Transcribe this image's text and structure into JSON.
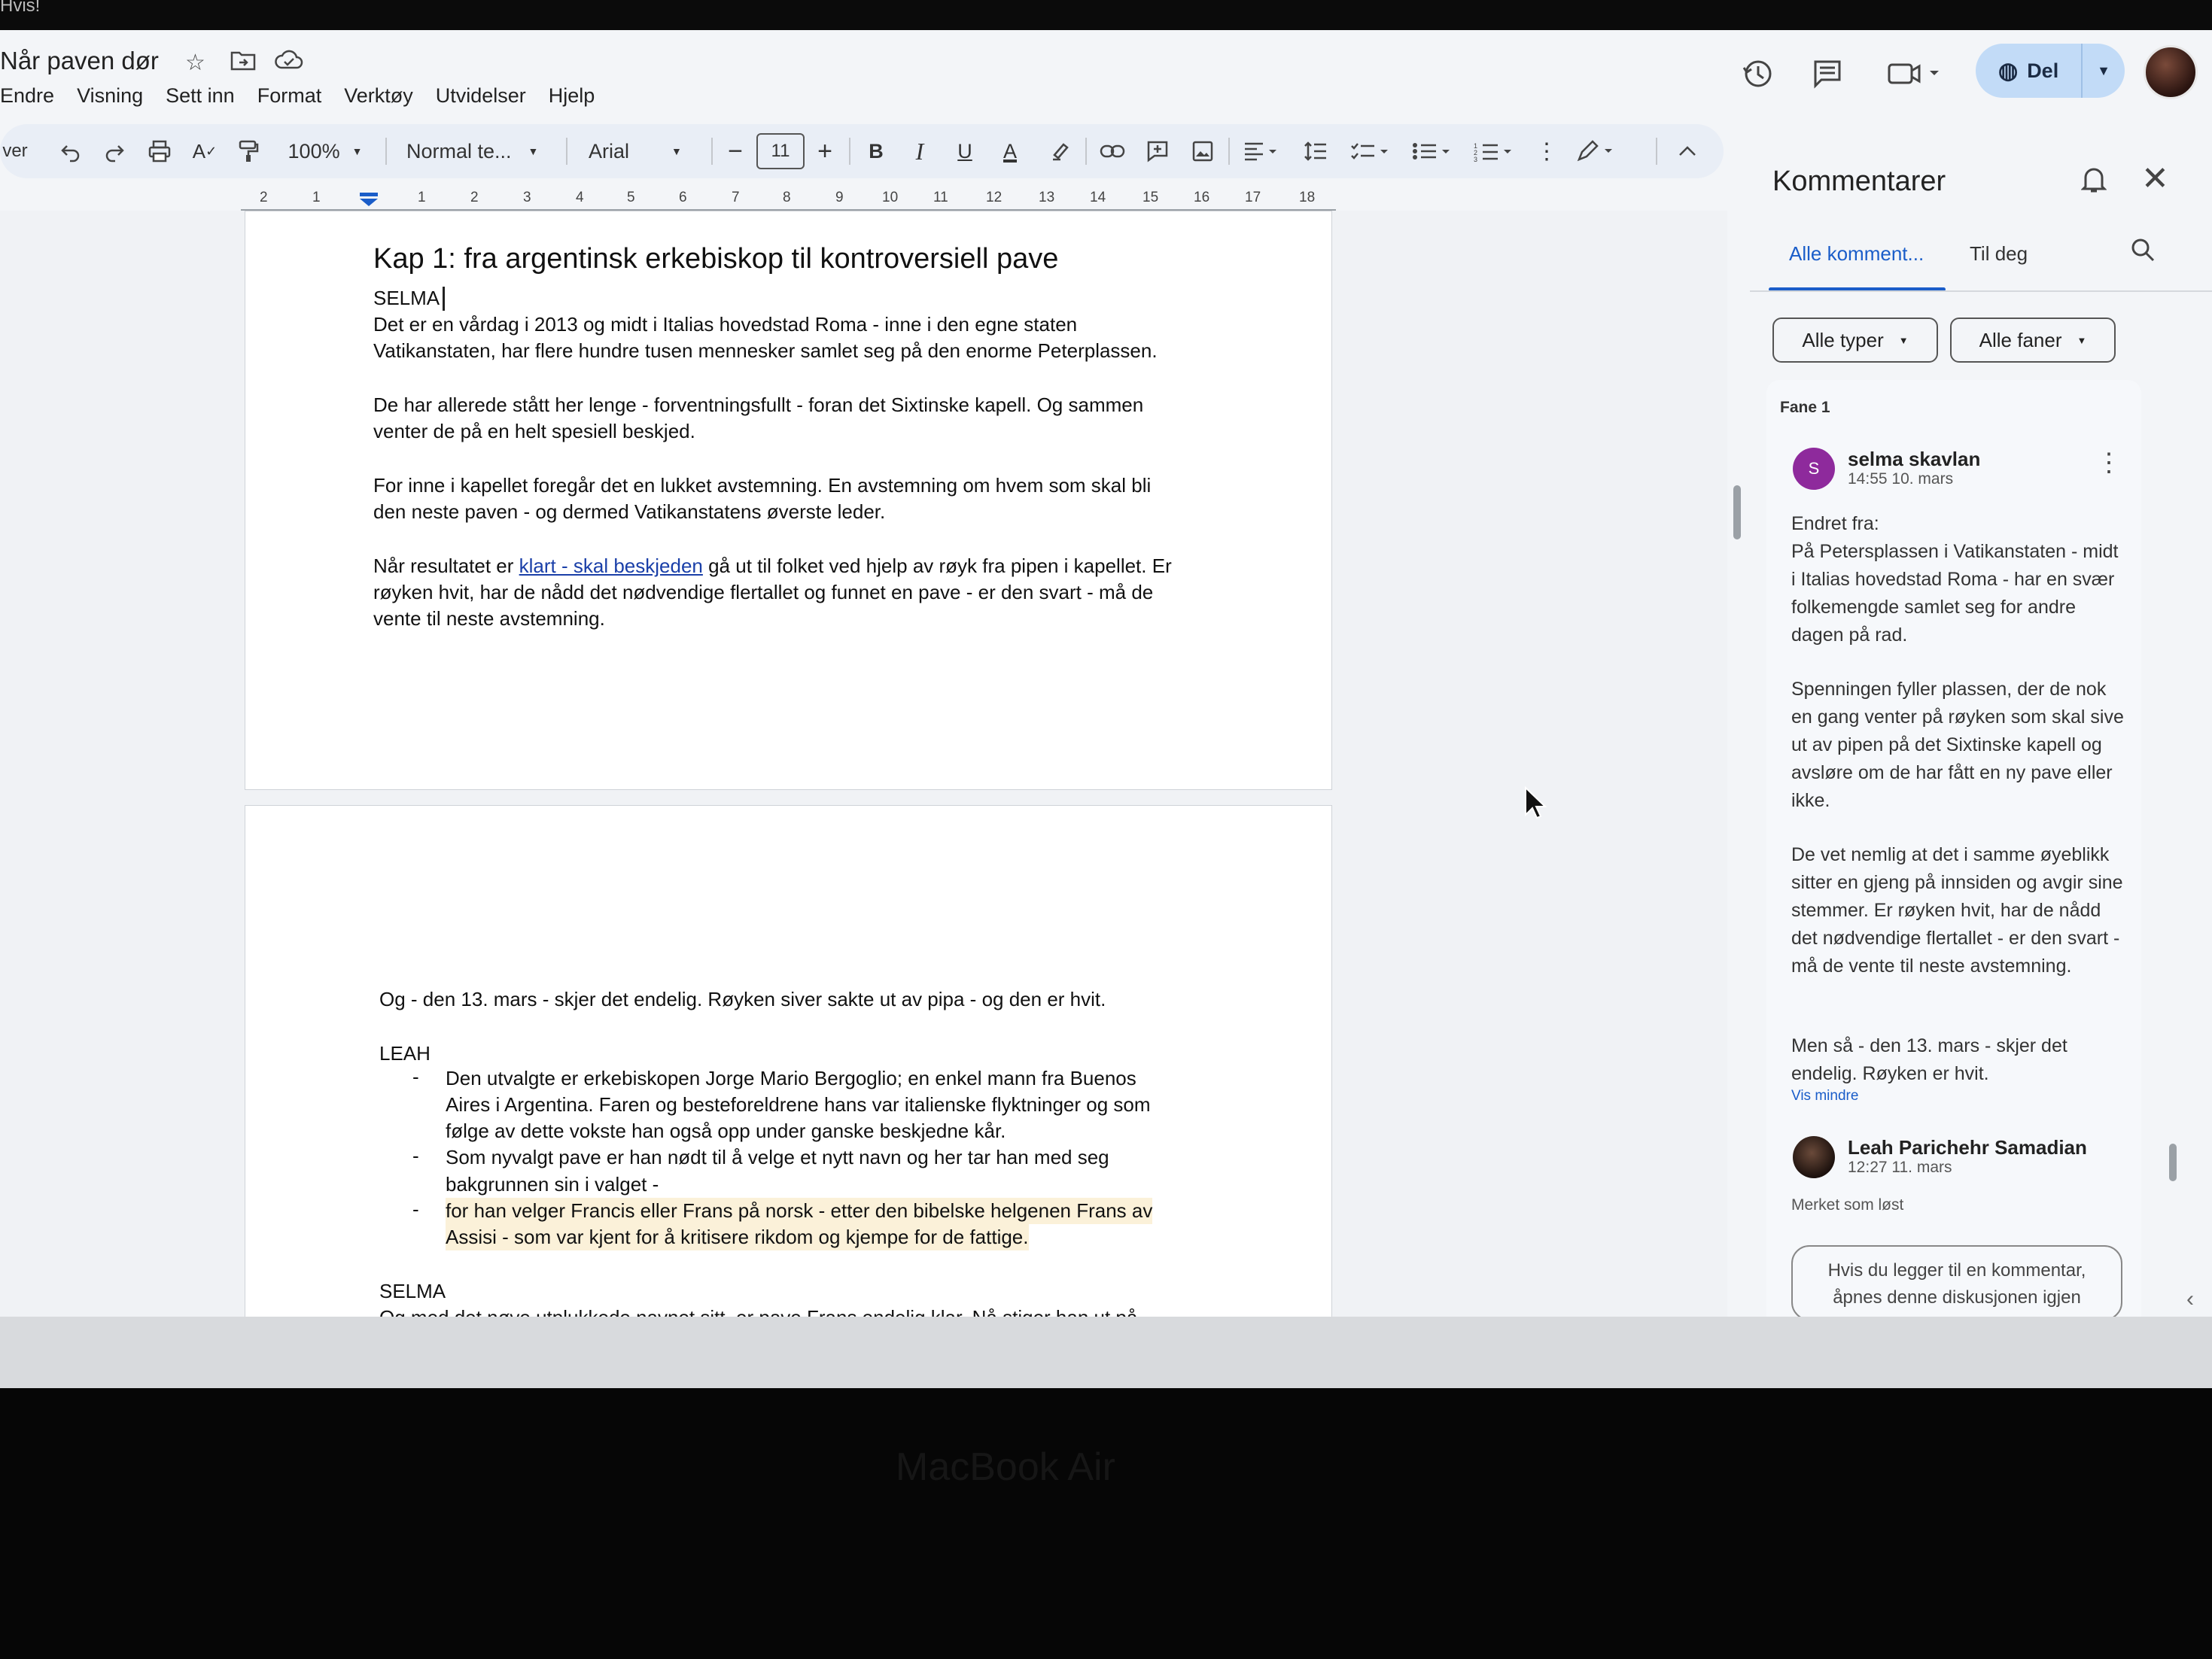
{
  "top_fragment": "Hvis!",
  "doc": {
    "title": "Når paven dør",
    "menu": [
      "Endre",
      "Visning",
      "Sett inn",
      "Format",
      "Verktøy",
      "Utvidelser",
      "Hjelp"
    ],
    "share_label": "Del"
  },
  "toolbar": {
    "left_fragment": "ver",
    "zoom": "100%",
    "style": "Normal te...",
    "font": "Arial",
    "font_size": "11",
    "bold": "B",
    "italic": "I",
    "underline": "U",
    "text_color": "A"
  },
  "ruler": [
    "2",
    "1",
    "1",
    "2",
    "3",
    "4",
    "5",
    "6",
    "7",
    "8",
    "9",
    "10",
    "11",
    "12",
    "13",
    "14",
    "15",
    "16",
    "17",
    "18"
  ],
  "page1": {
    "heading": "Kap 1: fra argentinsk erkebiskop til kontroversiell pave",
    "speaker1": "SELMA",
    "p1_l1": "Det er en vårdag i 2013 og midt i Italias hovedstad Roma - inne i den egne staten",
    "p1_l2": "Vatikanstaten, har flere hundre tusen mennesker samlet seg på den enorme Peterplassen.",
    "p2_l1": "De har allerede stått her lenge - forventningsfullt - foran det Sixtinske kapell. Og sammen",
    "p2_l2": "venter de på en helt spesiell beskjed.",
    "p3_l1": "For inne i kapellet foregår det en lukket avstemning. En avstemning om hvem som skal bli",
    "p3_l2": "den neste paven - og dermed Vatikanstatens øverste leder.",
    "p4_l1_a": "Når resultatet er ",
    "p4_l1_link": "klart - skal beskjeden",
    "p4_l1_b": " gå ut til folket ved hjelp av røyk fra pipen i kapellet. Er",
    "p4_l2": "røyken hvit, har de nådd det nødvendige flertallet og funnet en pave - er den svart - må de",
    "p4_l3": "vente til neste avstemning."
  },
  "page2": {
    "p1": "Og - den 13. mars - skjer det endelig. Røyken siver sakte ut av pipa - og den er hvit.",
    "speaker2": "LEAH",
    "b1_l1": "Den utvalgte er erkebiskopen Jorge Mario Bergoglio; en enkel mann fra Buenos",
    "b1_l2": "Aires i Argentina. Faren og besteforeldrene hans var italienske flyktninger og som",
    "b1_l3": "følge av dette vokste han også opp under ganske beskjedne kår.",
    "b2_l1": "Som nyvalgt pave er han nødt til å velge et nytt navn og her tar han med seg",
    "b2_l2": "bakgrunnen sin i valget -",
    "b3_l1": "for han velger Francis eller Frans på norsk - etter den bibelske helgenen Frans av",
    "b3_l2": "Assisi - som var kjent for å kritisere rikdom og kjempe for de fattige.",
    "dash": "-",
    "speaker3": "SELMA",
    "p2": "Og med det nøye utplukkede navnet sitt, er pave Frans endelig klar. Nå stiger han ut på"
  },
  "comments": {
    "title": "Kommentarer",
    "tab_all": "Alle komment...",
    "tab_you": "Til deg",
    "filter_types": "Alle typer",
    "filter_tabs": "Alle faner",
    "fane": "Fane 1",
    "c1_initial": "S",
    "c1_author": "selma skavlan",
    "c1_time": "14:55 10. mars",
    "c1_body_intro": "Endret fra:",
    "c1_body_p1": "På Petersplassen i Vatikanstaten - midt i Italias hovedstad Roma - har en svær folkemengde samlet seg for andre dagen på rad.",
    "c1_body_p2": "Spenningen fyller plassen, der de nok en gang venter på røyken som skal sive ut av pipen på det Sixtinske kapell og avsløre om de har fått en ny pave eller ikke.",
    "c1_body_p3": "De vet nemlig at det i samme øyeblikk sitter en gjeng på innsiden og avgir sine stemmer. Er røyken hvit, har de nådd det nødvendige flertallet - er den svart - må de vente til neste avstemning.",
    "c1_body_p4": "Men så - den 13. mars - skjer det endelig. Røyken er hvit.",
    "c1_less": "Vis mindre",
    "c2_author": "Leah Parichehr Samadian",
    "c2_time": "12:27 11. mars",
    "c2_status": "Merket som løst",
    "reply_placeholder": "Hvis du legger til en kommentar, åpnes denne diskusjonen igjen"
  },
  "laptop_label": "MacBook Air",
  "colors": {
    "accent": "#1a5dc9",
    "share_bg": "#c2dbf7",
    "avatar_purple": "#8e2a9c"
  }
}
